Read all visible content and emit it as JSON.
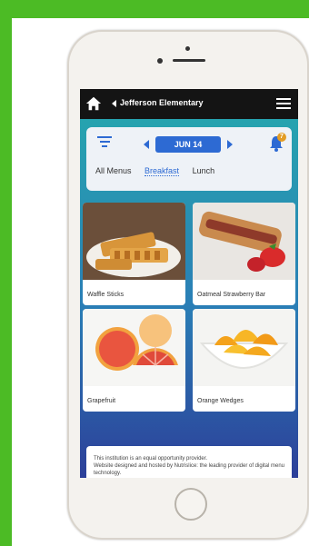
{
  "header": {
    "school_name": "Jefferson Elementary"
  },
  "date_nav": {
    "date_label": "JUN 14",
    "notification_count": "7"
  },
  "tabs": [
    {
      "label": "All Menus"
    },
    {
      "label": "Breakfast",
      "active": true
    },
    {
      "label": "Lunch"
    }
  ],
  "menu_items": [
    {
      "name": "Waffle Sticks"
    },
    {
      "name": "Oatmeal Strawberry Bar"
    },
    {
      "name": "Grapefruit"
    },
    {
      "name": "Orange Wedges"
    }
  ],
  "footer": {
    "line1": "This institution is an equal opportunity provider.",
    "line2": "Website designed and hosted by Nutrislice: the leading provider of digital menu technology."
  },
  "colors": {
    "brand_green": "#4cbb25",
    "accent_blue": "#2d6ad3",
    "badge_orange": "#e39d25"
  }
}
